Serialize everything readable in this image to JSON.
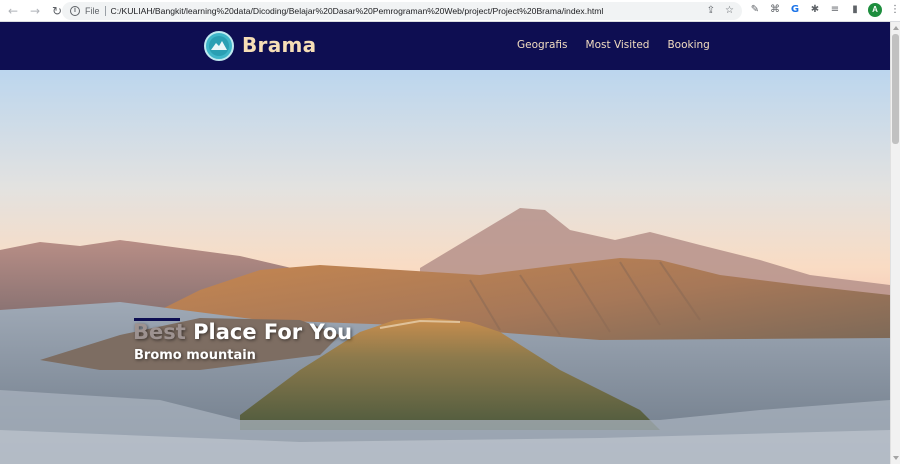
{
  "browser": {
    "scheme_label": "File",
    "url": "C:/KULIAH/Bangkit/learning%20data/Dicoding/Belajar%20Dasar%20Pemrograman%20Web/project/Project%20Brama/index.html",
    "profile_initial": "A",
    "icons": {
      "back": "←",
      "forward": "→",
      "reload": "↻",
      "info": "i",
      "share": "⇪",
      "bookmark": "☆",
      "ext1": "✎",
      "ext2": "⌘",
      "ext3": "G",
      "ext4": "✱",
      "ext5": "≡",
      "sidepanel": "▮",
      "menu": "⋮"
    }
  },
  "site": {
    "brand": "Brama",
    "nav": [
      "Geografis",
      "Most Visited",
      "Booking"
    ],
    "hero": {
      "title_muted": "Best",
      "title_rest": " Place For You",
      "subtitle": "Bromo mountain"
    }
  },
  "colors": {
    "navbar_bg": "#0e0e52",
    "brand_text": "#f6deb6",
    "logo": "#3fb6c9"
  }
}
